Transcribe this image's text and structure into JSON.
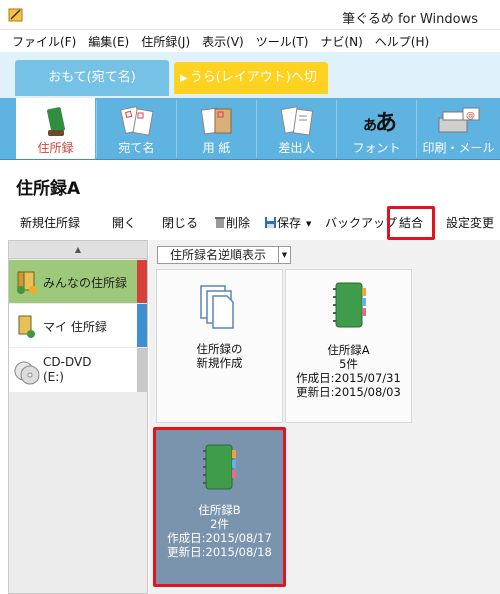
{
  "window": {
    "title": "筆ぐるめ for Windows"
  },
  "menu": [
    "ファイル(F)",
    "編集(E)",
    "住所録(J)",
    "表示(V)",
    "ツール(T)",
    "ナビ(N)",
    "ヘルプ(H)"
  ],
  "tabs": {
    "front": "おもて(宛て名)",
    "back": "うら(レイアウト)へ切替"
  },
  "icon_toolbar": [
    {
      "label": "住所録",
      "active": true
    },
    {
      "label": "宛て名",
      "active": false
    },
    {
      "label": "用 紙",
      "active": false
    },
    {
      "label": "差出人",
      "active": false
    },
    {
      "label": "フォント",
      "active": false
    },
    {
      "label": "印刷・メール",
      "active": false
    }
  ],
  "page_title": "住所録A",
  "commands": {
    "new": "新規住所録",
    "open": "開く",
    "close": "閉じる",
    "delete": "削除",
    "save": "保存",
    "backup": "バックアップ",
    "merge": "結合",
    "settings": "設定変更"
  },
  "sidebar": [
    {
      "label": "みんなの住所録",
      "selected": true,
      "stripe": "#d9403a"
    },
    {
      "label": "マイ 住所録",
      "selected": false,
      "stripe": "#3c8fd0"
    },
    {
      "label": "CD-DVD",
      "sub": "(E:)",
      "selected": false,
      "stripe": "#c8c8c8"
    }
  ],
  "sort": {
    "label": "住所録名逆順表示"
  },
  "cards": [
    {
      "type": "new",
      "line1": "住所録の",
      "line2": "新規作成"
    },
    {
      "type": "book",
      "name": "住所録A",
      "count": "5件",
      "created": "作成日:2015/07/31",
      "updated": "更新日:2015/08/03",
      "selected": false
    },
    {
      "type": "book",
      "name": "住所録B",
      "count": "2件",
      "created": "作成日:2015/08/17",
      "updated": "更新日:2015/08/18",
      "selected": true
    }
  ],
  "colors": {
    "accent_red": "#e0141e",
    "toolbar_blue": "#5fb3e0",
    "tab_blue": "#76c2e7",
    "tab_yellow": "#ffd21f",
    "sidebar_selected": "#9fc97a",
    "card_selected": "#7b94ad"
  }
}
